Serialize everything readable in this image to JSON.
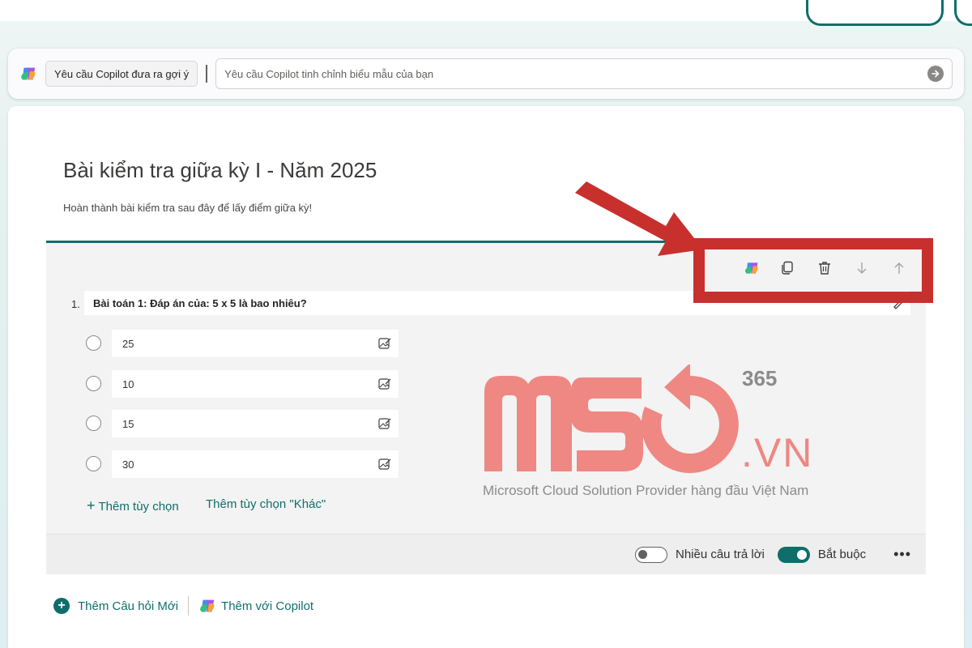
{
  "copilot_bar": {
    "suggest_label": "Yêu cầu Copilot đưa ra gợi ý",
    "refine_placeholder": "Yêu cầu Copilot tinh chỉnh biểu mẫu của bạn"
  },
  "form": {
    "title": "Bài kiểm tra giữa kỳ I - Năm 2025",
    "description": "Hoàn thành bài kiểm tra sau đây để lấy điểm giữa kỳ!"
  },
  "question": {
    "number": "1.",
    "title": "Bài toán 1: Đáp án của: 5 x 5 là bao nhiêu?",
    "options": [
      "25",
      "10",
      "15",
      "30"
    ],
    "add_option_label": "Thêm tùy chọn",
    "add_other_label": "Thêm tùy chọn \"Khác\"",
    "multiple_answers_label": "Nhiều câu trả lời",
    "required_label": "Bắt buộc",
    "multiple_answers_on": false,
    "required_on": true
  },
  "bottom": {
    "add_question_label": "Thêm Câu hỏi Mới",
    "add_with_copilot_label": "Thêm với Copilot"
  },
  "watermark": {
    "letters": "MSO",
    "superscript": "365",
    "suffix": ".VN",
    "tagline": "Microsoft Cloud Solution Provider hàng đầu Việt Nam"
  },
  "colors": {
    "accent": "#0f6e6a",
    "highlight_red": "#c8302d",
    "watermark_pink": "#ef8783"
  }
}
